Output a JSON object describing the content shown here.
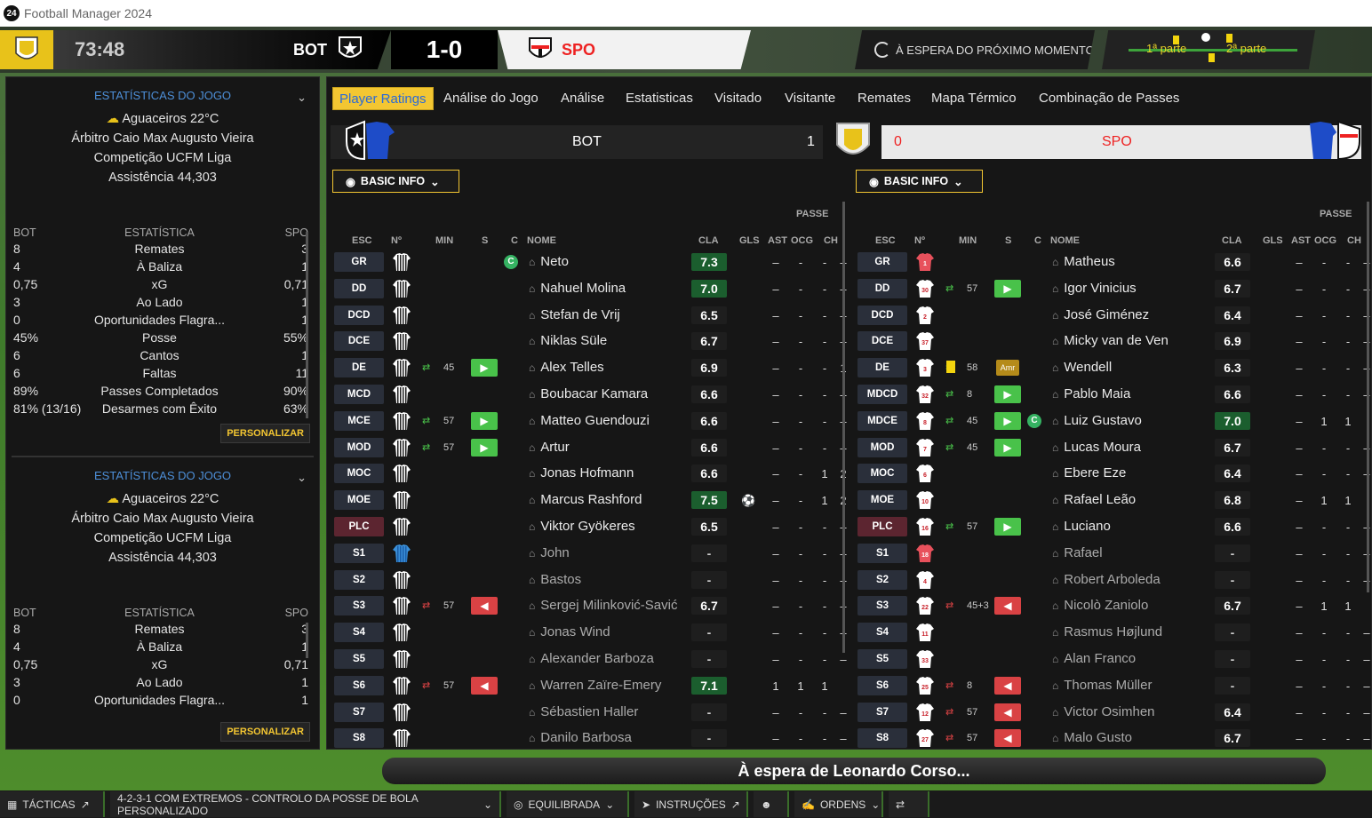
{
  "app": {
    "title": "Football Manager 2024",
    "logo": "24"
  },
  "scoreboard": {
    "clock": "73:48",
    "home": "BOT",
    "score": "1-0",
    "away": "SPO",
    "status": "À ESPERA DO PRÓXIMO MOMENTO",
    "half1": "1ª parte",
    "half2": "2ª parte"
  },
  "left_panel": {
    "sections": [
      {
        "header": "ESTATÍSTICAS DO JOGO",
        "weather": "Aguaceiros 22°C",
        "referee": "Árbitro Caio Max Augusto Vieira",
        "competition": "Competição UCFM Liga",
        "attendance": "Assistência 44,303",
        "col_home": "BOT",
        "col_stat": "ESTATÍSTICA",
        "col_away": "SPO",
        "stats": [
          {
            "home": "8",
            "name": "Remates",
            "away": "3"
          },
          {
            "home": "4",
            "name": "À Baliza",
            "away": "1"
          },
          {
            "home": "0,75",
            "name": "xG",
            "away": "0,71"
          },
          {
            "home": "3",
            "name": "Ao Lado",
            "away": "1"
          },
          {
            "home": "0",
            "name": "Oportunidades Flagra...",
            "away": "1"
          },
          {
            "home": "45%",
            "name": "Posse",
            "away": "55%"
          },
          {
            "home": "6",
            "name": "Cantos",
            "away": "1"
          },
          {
            "home": "6",
            "name": "Faltas",
            "away": "11"
          },
          {
            "home": "89%",
            "name": "Passes Completados",
            "away": "90%"
          },
          {
            "home": "81% (13/16)",
            "name": "Desarmes com Êxito",
            "away": "63%"
          }
        ],
        "button": "PERSONALIZAR"
      },
      {
        "header": "ESTATÍSTICAS DO JOGO",
        "weather": "Aguaceiros 22°C",
        "referee": "Árbitro Caio Max Augusto Vieira",
        "competition": "Competição UCFM Liga",
        "attendance": "Assistência 44,303",
        "col_home": "BOT",
        "col_stat": "ESTATÍSTICA",
        "col_away": "SPO",
        "stats": [
          {
            "home": "8",
            "name": "Remates",
            "away": "3"
          },
          {
            "home": "4",
            "name": "À Baliza",
            "away": "1"
          },
          {
            "home": "0,75",
            "name": "xG",
            "away": "0,71"
          },
          {
            "home": "3",
            "name": "Ao Lado",
            "away": "1"
          },
          {
            "home": "0",
            "name": "Oportunidades Flagra...",
            "away": "1"
          }
        ],
        "button": "PERSONALIZAR"
      }
    ]
  },
  "tabs": [
    "Player Ratings",
    "Análise do Jogo",
    "Análise",
    "Estatisticas",
    "Visitado",
    "Visitante",
    "Remates",
    "Mapa Térmico",
    "Combinação de Passes"
  ],
  "home_bar": {
    "name": "BOT",
    "score": "1"
  },
  "away_bar": {
    "name": "SPO",
    "score": "0"
  },
  "basic_info": "BASIC INFO",
  "columns": {
    "group": "PASSE",
    "pos": "ESC",
    "num": "Nº",
    "min": "MIN",
    "s": "S",
    "c": "C",
    "name": "NOME",
    "cla": "CLA",
    "gls": "GLS",
    "ast": "AST",
    "ocg": "OCG",
    "ch": "CH"
  },
  "colors": {
    "accent": "#f3c632",
    "good": "#49c24a",
    "bad": "#d94244",
    "tab_text": "#2a6ad8"
  },
  "home_players": [
    {
      "pos": "GR",
      "min": "",
      "sub": "",
      "cap": true,
      "name": "Neto",
      "cla": "7.3",
      "hi": true,
      "gls": "–",
      "ast": "-",
      "ocg": "-",
      "ch": "–",
      "bench": false
    },
    {
      "pos": "DD",
      "min": "",
      "sub": "",
      "name": "Nahuel Molina",
      "cla": "7.0",
      "hi": true,
      "gls": "–",
      "ast": "-",
      "ocg": "-",
      "ch": "–"
    },
    {
      "pos": "DCD",
      "min": "",
      "sub": "",
      "name": "Stefan de Vrij",
      "cla": "6.5",
      "gls": "–",
      "ast": "-",
      "ocg": "-",
      "ch": "–"
    },
    {
      "pos": "DCE",
      "min": "",
      "sub": "",
      "name": "Niklas Süle",
      "cla": "6.7",
      "gls": "–",
      "ast": "-",
      "ocg": "-",
      "ch": "–"
    },
    {
      "pos": "DE",
      "min": "45",
      "sub": "on",
      "name": "Alex Telles",
      "cla": "6.9",
      "gls": "–",
      "ast": "-",
      "ocg": "-",
      "ch": "1"
    },
    {
      "pos": "MCD",
      "min": "",
      "sub": "",
      "name": "Boubacar Kamara",
      "cla": "6.6",
      "gls": "–",
      "ast": "-",
      "ocg": "-",
      "ch": "–"
    },
    {
      "pos": "MCE",
      "min": "57",
      "sub": "on",
      "name": "Matteo Guendouzi",
      "cla": "6.6",
      "gls": "–",
      "ast": "-",
      "ocg": "-",
      "ch": "–"
    },
    {
      "pos": "MOD",
      "min": "57",
      "sub": "on",
      "name": "Artur",
      "cla": "6.6",
      "gls": "–",
      "ast": "-",
      "ocg": "-",
      "ch": "–"
    },
    {
      "pos": "MOC",
      "min": "",
      "sub": "",
      "name": "Jonas Hofmann",
      "cla": "6.6",
      "gls": "–",
      "ast": "-",
      "ocg": "1",
      "ch": "2"
    },
    {
      "pos": "MOE",
      "min": "",
      "sub": "",
      "name": "Marcus Rashford",
      "cla": "7.5",
      "hi": true,
      "goal": true,
      "gls": "–",
      "ast": "-",
      "ocg": "1",
      "ch": "2"
    },
    {
      "pos": "PLC",
      "min": "",
      "sub": "",
      "name": "Viktor Gyökeres",
      "cla": "6.5",
      "gls": "–",
      "ast": "-",
      "ocg": "-",
      "ch": "–",
      "fwd": true
    },
    {
      "pos": "S1",
      "min": "",
      "sub": "",
      "name": "John",
      "cla": "-",
      "gls": "–",
      "ast": "-",
      "ocg": "-",
      "ch": "–",
      "bench": true,
      "gk": true
    },
    {
      "pos": "S2",
      "min": "",
      "sub": "",
      "name": "Bastos",
      "cla": "-",
      "gls": "–",
      "ast": "-",
      "ocg": "-",
      "ch": "–",
      "bench": true
    },
    {
      "pos": "S3",
      "min": "57",
      "sub": "off",
      "name": "Sergej Milinković-Savić",
      "cla": "6.7",
      "gls": "–",
      "ast": "-",
      "ocg": "-",
      "ch": "–",
      "bench": true
    },
    {
      "pos": "S4",
      "min": "",
      "sub": "",
      "name": "Jonas Wind",
      "cla": "-",
      "gls": "–",
      "ast": "-",
      "ocg": "-",
      "ch": "–",
      "bench": true
    },
    {
      "pos": "S5",
      "min": "",
      "sub": "",
      "name": "Alexander Barboza",
      "cla": "-",
      "gls": "–",
      "ast": "-",
      "ocg": "-",
      "ch": "–",
      "bench": true
    },
    {
      "pos": "S6",
      "min": "57",
      "sub": "off",
      "name": "Warren Zaïre-Emery",
      "cla": "7.1",
      "hi": true,
      "gls": "1",
      "ast": "1",
      "ocg": "1",
      "ch": "",
      "bench": true
    },
    {
      "pos": "S7",
      "min": "",
      "sub": "",
      "name": "Sébastien Haller",
      "cla": "-",
      "gls": "–",
      "ast": "-",
      "ocg": "-",
      "ch": "–",
      "bench": true
    },
    {
      "pos": "S8",
      "min": "",
      "sub": "",
      "name": "Danilo Barbosa",
      "cla": "-",
      "gls": "–",
      "ast": "-",
      "ocg": "-",
      "ch": "–",
      "bench": true
    }
  ],
  "away_players": [
    {
      "pos": "GR",
      "num": "1",
      "min": "",
      "sub": "",
      "name": "Matheus",
      "cla": "6.6",
      "gls": "–",
      "ast": "-",
      "ocg": "-",
      "ch": "–",
      "gk": true
    },
    {
      "pos": "DD",
      "num": "30",
      "min": "57",
      "sub": "on",
      "name": "Igor Vinicius",
      "cla": "6.7",
      "gls": "–",
      "ast": "-",
      "ocg": "-",
      "ch": "–"
    },
    {
      "pos": "DCD",
      "num": "2",
      "min": "",
      "sub": "",
      "name": "José Giménez",
      "cla": "6.4",
      "gls": "–",
      "ast": "-",
      "ocg": "-",
      "ch": "–"
    },
    {
      "pos": "DCE",
      "num": "37",
      "min": "",
      "sub": "",
      "name": "Micky van de Ven",
      "cla": "6.9",
      "gls": "–",
      "ast": "-",
      "ocg": "-",
      "ch": "–"
    },
    {
      "pos": "DE",
      "num": "3",
      "min": "58",
      "sub": "amr",
      "yc": true,
      "amr": "Amr",
      "name": "Wendell",
      "cla": "6.3",
      "gls": "–",
      "ast": "-",
      "ocg": "-",
      "ch": "–"
    },
    {
      "pos": "MDCD",
      "num": "32",
      "min": "8",
      "sub": "on",
      "name": "Pablo Maia",
      "cla": "6.6",
      "gls": "–",
      "ast": "-",
      "ocg": "-",
      "ch": "–"
    },
    {
      "pos": "MDCE",
      "num": "8",
      "min": "45",
      "sub": "on",
      "cap": true,
      "name": "Luiz Gustavo",
      "cla": "7.0",
      "hi": true,
      "gls": "–",
      "ast": "1",
      "ocg": "1",
      "ch": ""
    },
    {
      "pos": "MOD",
      "num": "7",
      "min": "45",
      "sub": "on",
      "name": "Lucas Moura",
      "cla": "6.7",
      "gls": "–",
      "ast": "-",
      "ocg": "-",
      "ch": "–"
    },
    {
      "pos": "MOC",
      "num": "6",
      "min": "",
      "sub": "",
      "name": "Ebere Eze",
      "cla": "6.4",
      "gls": "–",
      "ast": "-",
      "ocg": "-",
      "ch": "–"
    },
    {
      "pos": "MOE",
      "num": "10",
      "min": "",
      "sub": "",
      "name": "Rafael Leão",
      "cla": "6.8",
      "gls": "–",
      "ast": "1",
      "ocg": "1",
      "ch": ""
    },
    {
      "pos": "PLC",
      "num": "16",
      "min": "57",
      "sub": "on",
      "name": "Luciano",
      "cla": "6.6",
      "gls": "–",
      "ast": "-",
      "ocg": "-",
      "ch": "–",
      "fwd": true
    },
    {
      "pos": "S1",
      "num": "18",
      "min": "",
      "sub": "",
      "name": "Rafael",
      "cla": "-",
      "gls": "–",
      "ast": "-",
      "ocg": "-",
      "ch": "–",
      "bench": true,
      "gk": true
    },
    {
      "pos": "S2",
      "num": "4",
      "min": "",
      "sub": "",
      "name": "Robert Arboleda",
      "cla": "-",
      "gls": "–",
      "ast": "-",
      "ocg": "-",
      "ch": "–",
      "bench": true
    },
    {
      "pos": "S3",
      "num": "22",
      "min": "45+3",
      "sub": "off",
      "name": "Nicolò Zaniolo",
      "cla": "6.7",
      "gls": "–",
      "ast": "1",
      "ocg": "1",
      "ch": "",
      "bench": true
    },
    {
      "pos": "S4",
      "num": "11",
      "min": "",
      "sub": "",
      "name": "Rasmus Højlund",
      "cla": "-",
      "gls": "–",
      "ast": "-",
      "ocg": "-",
      "ch": "–",
      "bench": true
    },
    {
      "pos": "S5",
      "num": "33",
      "min": "",
      "sub": "",
      "name": "Alan Franco",
      "cla": "-",
      "gls": "–",
      "ast": "-",
      "ocg": "-",
      "ch": "–",
      "bench": true
    },
    {
      "pos": "S6",
      "num": "25",
      "min": "8",
      "sub": "off",
      "name": "Thomas Müller",
      "cla": "-",
      "gls": "–",
      "ast": "-",
      "ocg": "-",
      "ch": "–",
      "bench": true
    },
    {
      "pos": "S7",
      "num": "12",
      "min": "57",
      "sub": "off",
      "name": "Victor Osimhen",
      "cla": "6.4",
      "gls": "–",
      "ast": "-",
      "ocg": "-",
      "ch": "–",
      "bench": true
    },
    {
      "pos": "S8",
      "num": "27",
      "min": "57",
      "sub": "off",
      "name": "Malo Gusto",
      "cla": "6.7",
      "gls": "–",
      "ast": "-",
      "ocg": "-",
      "ch": "–",
      "bench": true
    }
  ],
  "waiting": "À espera de Leonardo Corso...",
  "bottom": {
    "tactics": "TÁCTICAS",
    "formation": "4-2-3-1 COM EXTREMOS - CONTROLO DA POSSE DE BOLA PERSONALIZADO",
    "mentality": "EQUILIBRADA",
    "instructions": "INSTRUÇÕES",
    "orders": "ORDENS"
  }
}
